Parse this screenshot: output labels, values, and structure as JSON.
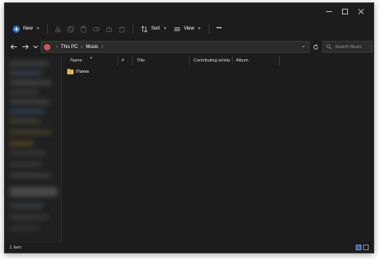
{
  "toolbar": {
    "new_label": "New",
    "sort_label": "Sort",
    "view_label": "View",
    "more_label": "•••"
  },
  "address": {
    "crumbs": [
      "This PC",
      "Music"
    ]
  },
  "search": {
    "placeholder": "Search Music"
  },
  "columns": {
    "name": "Name",
    "number": "#",
    "title": "Title",
    "contributing_artists": "Contributing artists",
    "album": "Album"
  },
  "files": [
    {
      "name": "iTunes",
      "type": "folder"
    }
  ],
  "status": {
    "item_count": "1 item"
  },
  "colors": {
    "window_bg": "#1c1c1c",
    "sidebar_bg": "#202020",
    "accent": "#2b6fd6",
    "folder": "#e8b54a"
  }
}
